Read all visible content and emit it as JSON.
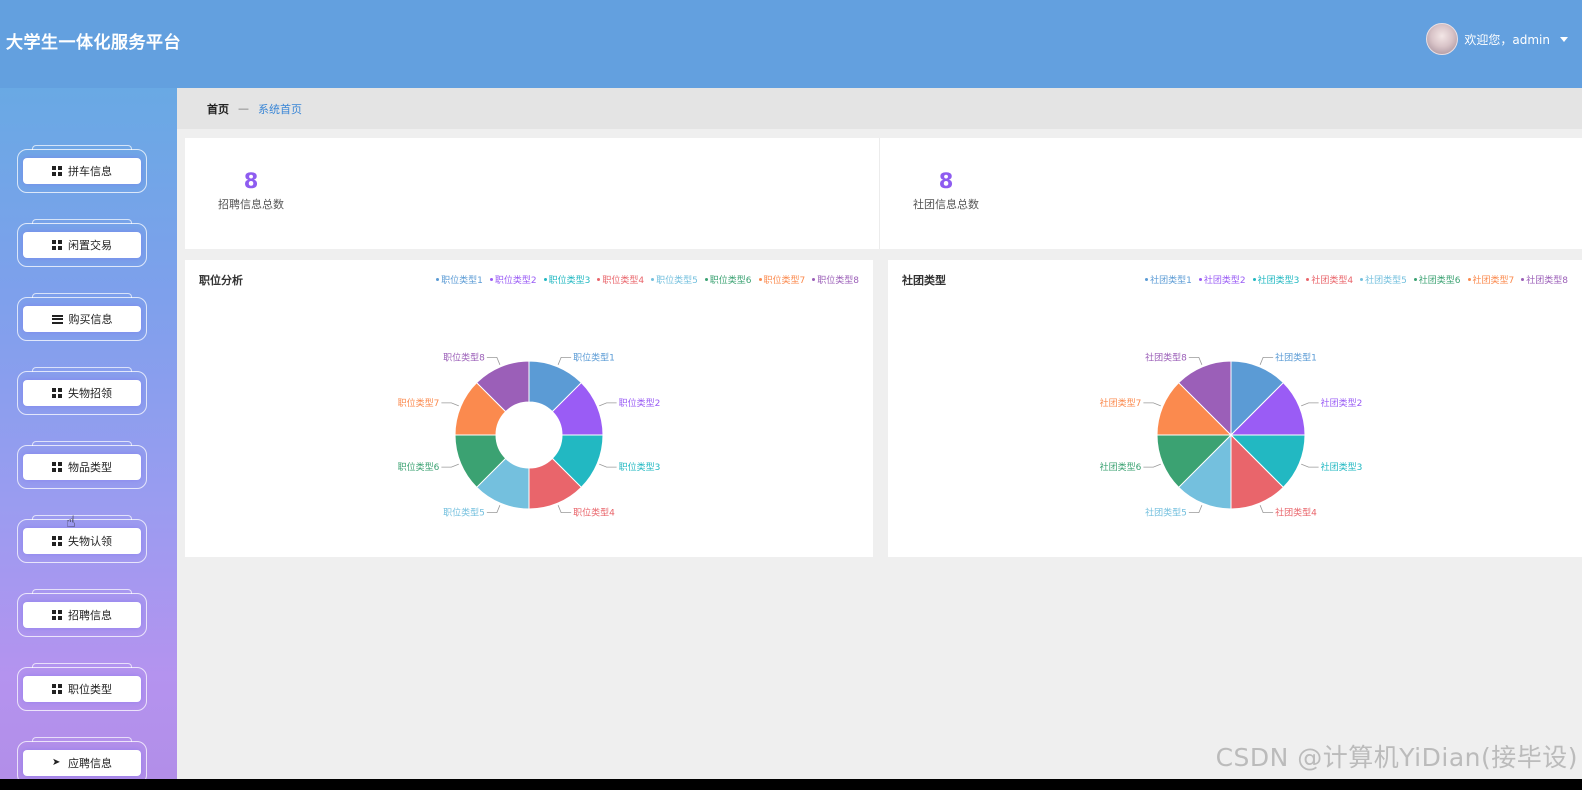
{
  "header": {
    "app_title": "大学生一体化服务平台",
    "welcome_text": "欢迎您，admin",
    "avatar_icon": "user-avatar",
    "caret_icon": "caret-down-icon",
    "color": "#63a0df"
  },
  "sidebar": {
    "items": [
      {
        "label": "拼车信息",
        "icon": "grid-icon"
      },
      {
        "label": "闲置交易",
        "icon": "grid-icon"
      },
      {
        "label": "购买信息",
        "icon": "list-icon"
      },
      {
        "label": "失物招领",
        "icon": "grid-icon"
      },
      {
        "label": "物品类型",
        "icon": "grid-icon"
      },
      {
        "label": "失物认领",
        "icon": "grid-icon"
      },
      {
        "label": "招聘信息",
        "icon": "grid-icon"
      },
      {
        "label": "职位类型",
        "icon": "grid-icon"
      },
      {
        "label": "应聘信息",
        "icon": "send-icon"
      }
    ]
  },
  "breadcrumb": {
    "home": "首页",
    "separator": "—",
    "current": "系统首页"
  },
  "stats": [
    {
      "value": "8",
      "label": "招聘信息总数"
    },
    {
      "value": "8",
      "label": "社团信息总数"
    }
  ],
  "colors": [
    "#5b9bd5",
    "#9a5cf5",
    "#22b8c2",
    "#e9656b",
    "#74c0de",
    "#3ba272",
    "#fb8a4e",
    "#9b5fb8"
  ],
  "chart_data": [
    {
      "type": "pie",
      "title": "职位分析",
      "donut": true,
      "legend": "top-right",
      "categories": [
        "职位类型1",
        "职位类型2",
        "职位类型3",
        "职位类型4",
        "职位类型5",
        "职位类型6",
        "职位类型7",
        "职位类型8"
      ],
      "values": [
        1,
        1,
        1,
        1,
        1,
        1,
        1,
        1
      ]
    },
    {
      "type": "pie",
      "title": "社团类型",
      "donut": false,
      "legend": "top-right",
      "categories": [
        "社团类型1",
        "社团类型2",
        "社团类型3",
        "社团类型4",
        "社团类型5",
        "社团类型6",
        "社团类型7",
        "社团类型8"
      ],
      "values": [
        1,
        1,
        1,
        1,
        1,
        1,
        1,
        1
      ]
    }
  ],
  "watermark": "CSDN @计算机YiDian(接毕设)"
}
